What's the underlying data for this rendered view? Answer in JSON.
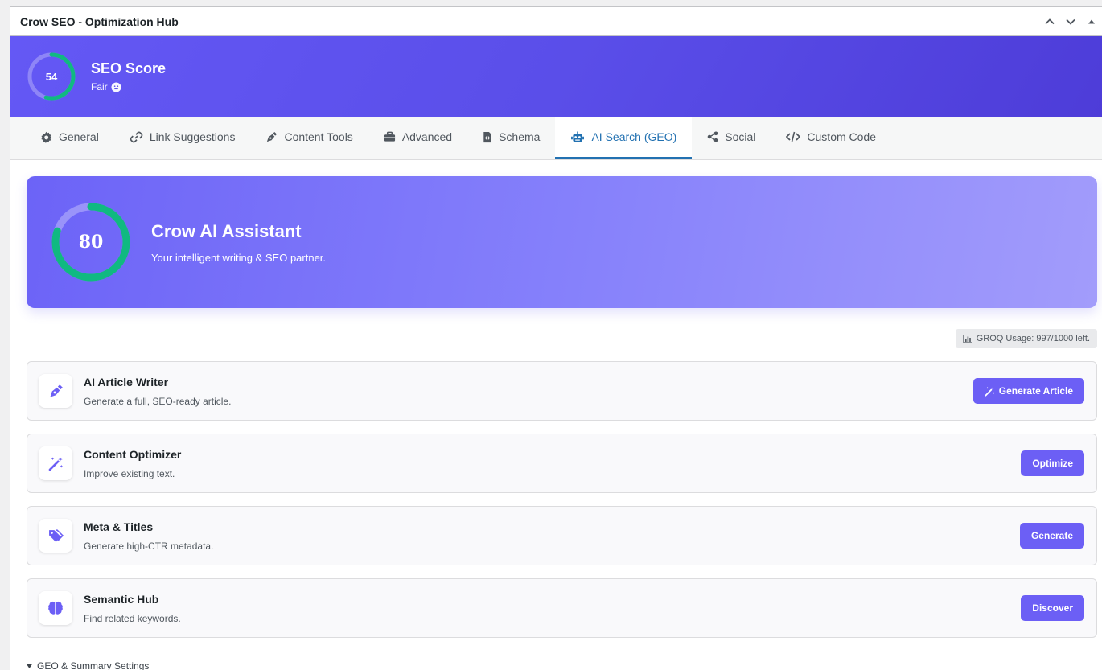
{
  "metabox": {
    "title": "Crow SEO - Optimization Hub"
  },
  "score": {
    "value": "54",
    "percent": 54,
    "title": "SEO Score",
    "rating": "Fair",
    "rating_icon": "neutral-face-icon"
  },
  "tabs": [
    {
      "label": "General",
      "icon": "gear-icon"
    },
    {
      "label": "Link Suggestions",
      "icon": "link-icon"
    },
    {
      "label": "Content Tools",
      "icon": "pen-nib-icon"
    },
    {
      "label": "Advanced",
      "icon": "briefcase-icon"
    },
    {
      "label": "Schema",
      "icon": "code-file-icon"
    },
    {
      "label": "AI Search (GEO)",
      "icon": "robot-icon",
      "active": true
    },
    {
      "label": "Social",
      "icon": "share-icon"
    },
    {
      "label": "Custom Code",
      "icon": "code-icon"
    }
  ],
  "assistant": {
    "score": "80",
    "percent": 80,
    "title": "Crow AI Assistant",
    "subtitle": "Your intelligent writing & SEO partner."
  },
  "usage": {
    "label": "GROQ Usage: 997/1000 left."
  },
  "tools": [
    {
      "title": "AI Article Writer",
      "desc": "Generate a full, SEO-ready article.",
      "button": "Generate Article",
      "icon": "pen-nib-icon"
    },
    {
      "title": "Content Optimizer",
      "desc": "Improve existing text.",
      "button": "Optimize",
      "icon": "magic-wand-icon"
    },
    {
      "title": "Meta & Titles",
      "desc": "Generate high-CTR metadata.",
      "button": "Generate",
      "icon": "tags-icon"
    },
    {
      "title": "Semantic Hub",
      "desc": "Find related keywords.",
      "button": "Discover",
      "icon": "brain-icon"
    }
  ],
  "geo_section": {
    "label": "GEO & Summary Settings"
  },
  "colors": {
    "accent": "#6c5ff5",
    "ring": "#10b981",
    "active_tab": "#2271b1"
  }
}
